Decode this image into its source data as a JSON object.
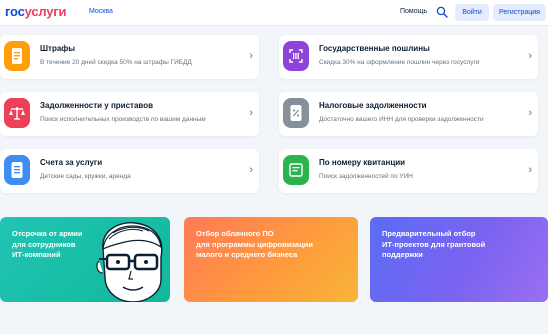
{
  "header": {
    "logo_part1": "гос",
    "logo_part2": "услуги",
    "city": "Москва",
    "help": "Помощь",
    "login": "Войти",
    "register": "Регистрация"
  },
  "cards": [
    {
      "title": "Штрафы",
      "desc": "В течение 20 дней скидка 50% на штрафы ГИБДД",
      "icon": "fine-icon",
      "color": "#ff9f0a"
    },
    {
      "title": "Государственные пошлины",
      "desc": "Скидка 30% на оформление пошлин через госуслуги",
      "icon": "duty-icon",
      "color": "#8e44d9"
    },
    {
      "title": "Задолженности у приставов",
      "desc": "Поиск исполнительных производств по вашим данным",
      "icon": "scales-icon",
      "color": "#ee3f58"
    },
    {
      "title": "Налоговые задолженности",
      "desc": "Достаточно вашего ИНН для проверки задолженности",
      "icon": "tax-icon",
      "color": "#86909c"
    },
    {
      "title": "Счета за услуги",
      "desc": "Детские сады, кружки, аренда",
      "icon": "bill-icon",
      "color": "#3d8ef0"
    },
    {
      "title": "По номеру квитанции",
      "desc": "Поиск задолженностей по УИН",
      "icon": "receipt-icon",
      "color": "#2bb44e"
    }
  ],
  "promos": [
    {
      "text": "Отсрочка от армии\nдля сотрудников\nИТ-компаний"
    },
    {
      "text": "Отбор облачного ПО\nдля программы цифровизации\nмалого и среднего бизнеса"
    },
    {
      "text": "Предварительный отбор\nИТ-проектов для грантовой\nподдержки"
    }
  ]
}
